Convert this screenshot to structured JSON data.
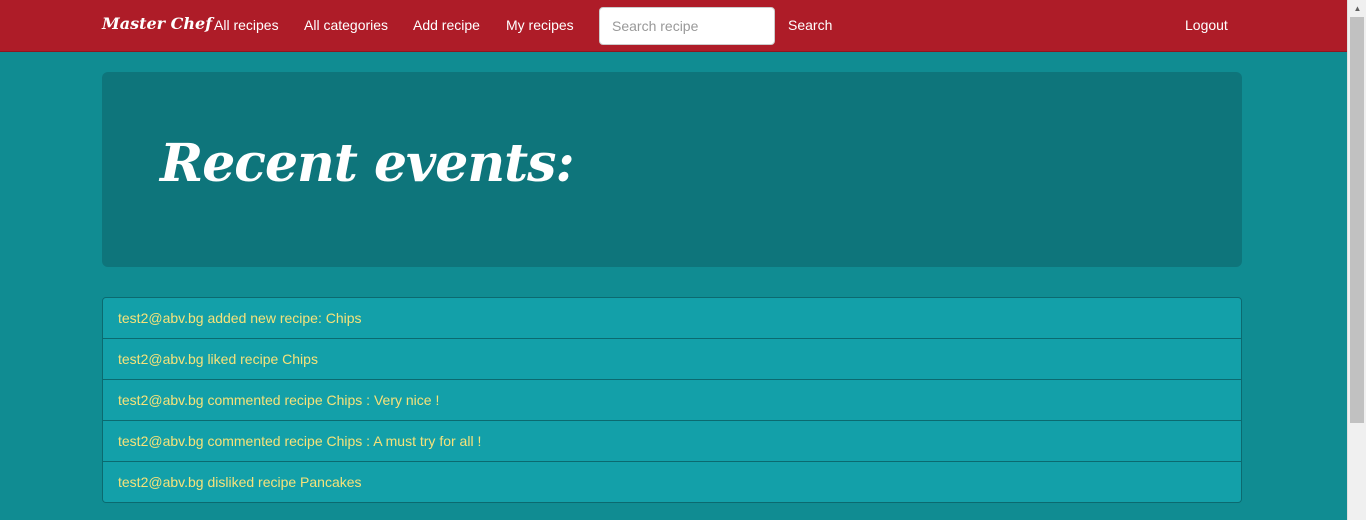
{
  "navbar": {
    "brand": "Master Chef",
    "links": [
      "All recipes",
      "All categories",
      "Add recipe",
      "My recipes"
    ],
    "search_placeholder": "Search recipe",
    "search_label": "Search",
    "logout_label": "Logout",
    "background_color": "#ae1c28"
  },
  "jumbotron": {
    "title": "Recent events:"
  },
  "events": [
    "test2@abv.bg added new recipe: Chips",
    "test2@abv.bg liked recipe Chips",
    "test2@abv.bg commented recipe Chips : Very nice !",
    "test2@abv.bg commented recipe Chips : A must try for all !",
    "test2@abv.bg disliked recipe Pancakes"
  ],
  "colors": {
    "page_background": "#108c92",
    "jumbotron_background": "#0e757b",
    "event_background": "#13a0a9",
    "event_text": "#f6e27a"
  }
}
